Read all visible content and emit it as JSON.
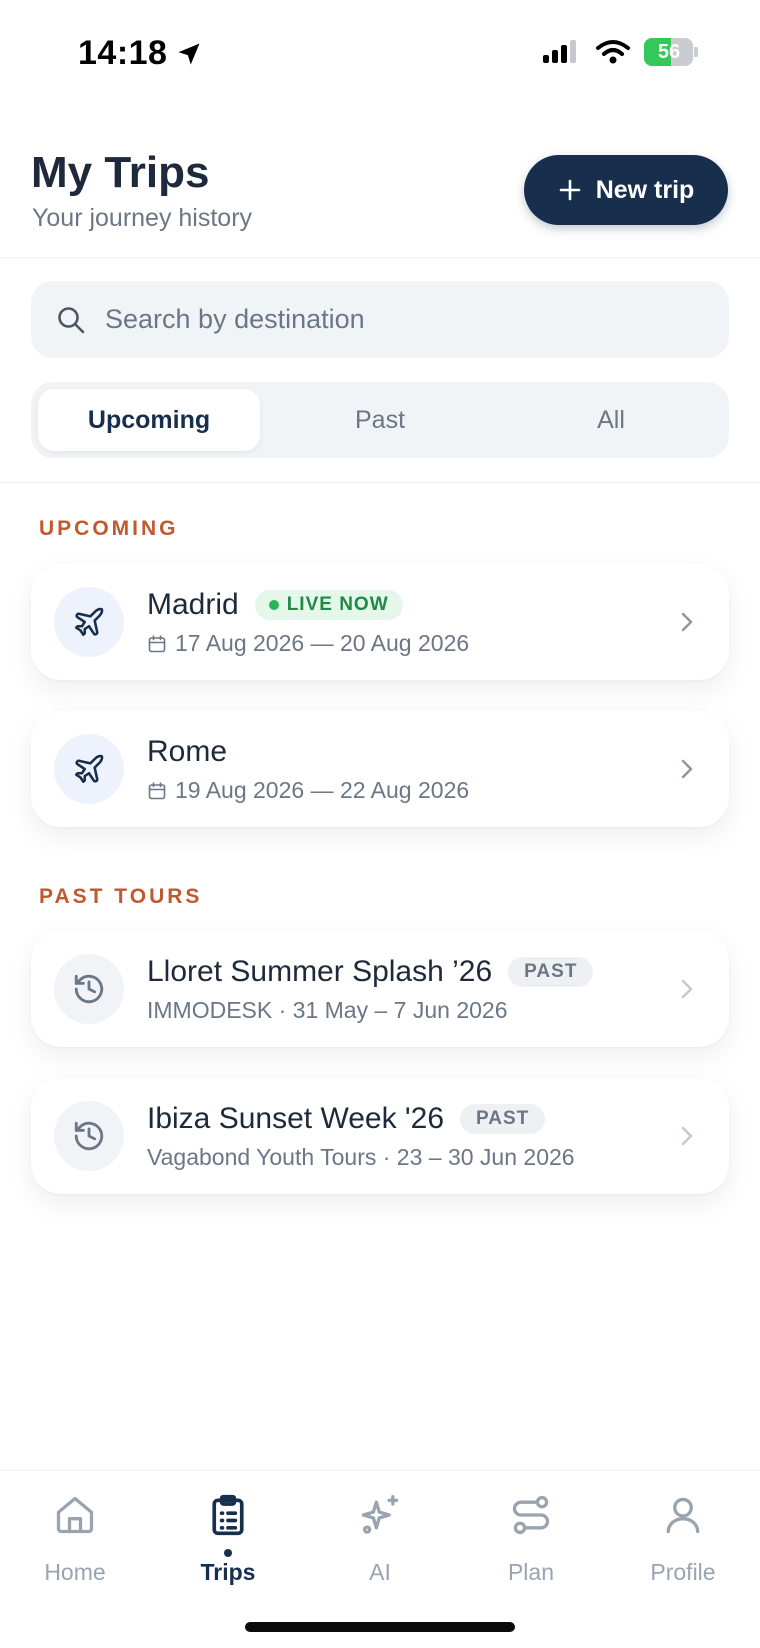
{
  "status_bar": {
    "time": "14:18",
    "battery_percent": "56",
    "battery_level": 0.56
  },
  "header": {
    "title": "My Trips",
    "subtitle": "Your journey history",
    "new_trip_label": "New trip"
  },
  "search": {
    "placeholder": "Search by destination",
    "value": ""
  },
  "filters": {
    "tabs": [
      {
        "label": "Upcoming",
        "active": true
      },
      {
        "label": "Past",
        "active": false
      },
      {
        "label": "All",
        "active": false
      }
    ]
  },
  "sections": {
    "upcoming_label": "UPCOMING",
    "past_label": "PAST TOURS"
  },
  "upcoming_trips": [
    {
      "title": "Madrid",
      "badge": "LIVE NOW",
      "dates": "17 Aug 2026 — 20 Aug 2026",
      "icon": "airplane-icon"
    },
    {
      "title": "Rome",
      "badge": "",
      "dates": "19 Aug 2026 — 22 Aug 2026",
      "icon": "airplane-icon"
    }
  ],
  "past_trips": [
    {
      "title": "Lloret Summer Splash ’26",
      "badge": "PAST",
      "meta": "IMMODESK · 31 May – 7 Jun 2026",
      "icon": "history-icon"
    },
    {
      "title": "Ibiza Sunset Week '26",
      "badge": "PAST",
      "meta": "Vagabond Youth Tours · 23 – 30 Jun 2026",
      "icon": "history-icon"
    }
  ],
  "tab_bar": {
    "items": [
      {
        "label": "Home",
        "icon": "home-icon",
        "active": false
      },
      {
        "label": "Trips",
        "icon": "clipboard-list-icon",
        "active": true
      },
      {
        "label": "AI",
        "icon": "sparkles-icon",
        "active": false
      },
      {
        "label": "Plan",
        "icon": "route-icon",
        "active": false
      },
      {
        "label": "Profile",
        "icon": "user-icon",
        "active": false
      }
    ]
  },
  "colors": {
    "primary": "#172e4d",
    "accent_section": "#c05a2e",
    "live_green": "#1f8a44",
    "battery_green": "#34c759"
  }
}
